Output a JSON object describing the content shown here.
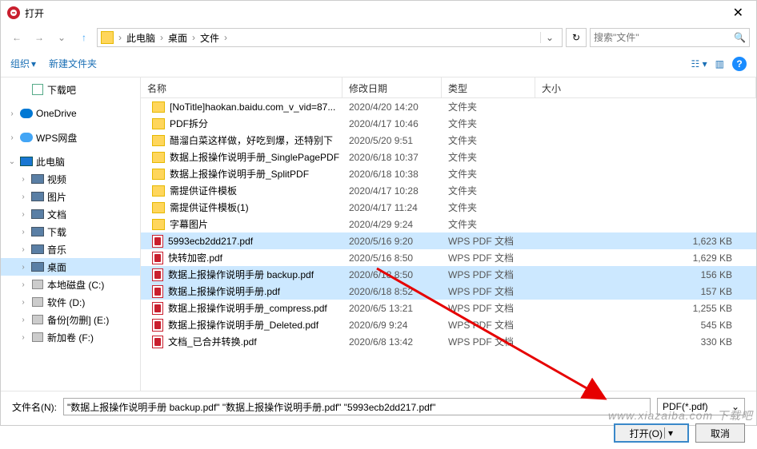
{
  "window": {
    "title": "打开"
  },
  "breadcrumb": {
    "segments": [
      "此电脑",
      "桌面",
      "文件"
    ]
  },
  "search": {
    "placeholder": "搜索\"文件\""
  },
  "toolbar": {
    "organize": "组织",
    "new_folder": "新建文件夹"
  },
  "sidebar": {
    "items": [
      {
        "label": "下载吧",
        "indent": 22,
        "exp": "",
        "icon": "download"
      },
      {
        "label": "OneDrive",
        "indent": 8,
        "exp": "›",
        "icon": "onedrive",
        "spacer_before": 8
      },
      {
        "label": "WPS网盘",
        "indent": 8,
        "exp": "›",
        "icon": "wps",
        "spacer_before": 8
      },
      {
        "label": "此电脑",
        "indent": 8,
        "exp": "⌄",
        "icon": "thispc",
        "spacer_before": 8
      },
      {
        "label": "视频",
        "indent": 22,
        "exp": "›",
        "icon": "gen"
      },
      {
        "label": "图片",
        "indent": 22,
        "exp": "›",
        "icon": "gen"
      },
      {
        "label": "文档",
        "indent": 22,
        "exp": "›",
        "icon": "gen"
      },
      {
        "label": "下载",
        "indent": 22,
        "exp": "›",
        "icon": "gen"
      },
      {
        "label": "音乐",
        "indent": 22,
        "exp": "›",
        "icon": "gen"
      },
      {
        "label": "桌面",
        "indent": 22,
        "exp": "›",
        "icon": "gen",
        "selected": true
      },
      {
        "label": "本地磁盘 (C:)",
        "indent": 22,
        "exp": "›",
        "icon": "disk"
      },
      {
        "label": "软件 (D:)",
        "indent": 22,
        "exp": "›",
        "icon": "disk"
      },
      {
        "label": "备份[勿删] (E:)",
        "indent": 22,
        "exp": "›",
        "icon": "disk"
      },
      {
        "label": "新加卷 (F:)",
        "indent": 22,
        "exp": "›",
        "icon": "disk"
      }
    ]
  },
  "columns": {
    "name": "名称",
    "date": "修改日期",
    "type": "类型",
    "size": "大小"
  },
  "files": [
    {
      "name": "[NoTitle]haokan.baidu.com_v_vid=87...",
      "date": "2020/4/20 14:20",
      "type": "文件夹",
      "size": "",
      "icon": "folder"
    },
    {
      "name": "PDF拆分",
      "date": "2020/4/17 10:46",
      "type": "文件夹",
      "size": "",
      "icon": "folder"
    },
    {
      "name": "醋溜白菜这样做，好吃到爆，还特别下",
      "date": "2020/5/20 9:51",
      "type": "文件夹",
      "size": "",
      "icon": "folder"
    },
    {
      "name": "数据上报操作说明手册_SinglePagePDF",
      "date": "2020/6/18 10:37",
      "type": "文件夹",
      "size": "",
      "icon": "folder"
    },
    {
      "name": "数据上报操作说明手册_SplitPDF",
      "date": "2020/6/18 10:38",
      "type": "文件夹",
      "size": "",
      "icon": "folder"
    },
    {
      "name": "需提供证件模板",
      "date": "2020/4/17 10:28",
      "type": "文件夹",
      "size": "",
      "icon": "folder"
    },
    {
      "name": "需提供证件模板(1)",
      "date": "2020/4/17 11:24",
      "type": "文件夹",
      "size": "",
      "icon": "folder"
    },
    {
      "name": "字幕图片",
      "date": "2020/4/29 9:24",
      "type": "文件夹",
      "size": "",
      "icon": "folder"
    },
    {
      "name": "5993ecb2dd217.pdf",
      "date": "2020/5/16 9:20",
      "type": "WPS PDF 文档",
      "size": "1,623 KB",
      "icon": "pdf",
      "selected": true
    },
    {
      "name": "快转加密.pdf",
      "date": "2020/5/16 8:50",
      "type": "WPS PDF 文档",
      "size": "1,629 KB",
      "icon": "pdf"
    },
    {
      "name": "数据上报操作说明手册 backup.pdf",
      "date": "2020/6/18 8:50",
      "type": "WPS PDF 文档",
      "size": "156 KB",
      "icon": "pdf",
      "selected": true
    },
    {
      "name": "数据上报操作说明手册.pdf",
      "date": "2020/6/18 8:52",
      "type": "WPS PDF 文档",
      "size": "157 KB",
      "icon": "pdf",
      "selected": true
    },
    {
      "name": "数据上报操作说明手册_compress.pdf",
      "date": "2020/6/5 13:21",
      "type": "WPS PDF 文档",
      "size": "1,255 KB",
      "icon": "pdf"
    },
    {
      "name": "数据上报操作说明手册_Deleted.pdf",
      "date": "2020/6/9 9:24",
      "type": "WPS PDF 文档",
      "size": "545 KB",
      "icon": "pdf"
    },
    {
      "name": "文档_已合并转换.pdf",
      "date": "2020/6/8 13:42",
      "type": "WPS PDF 文档",
      "size": "330 KB",
      "icon": "pdf"
    }
  ],
  "bottom": {
    "filename_label": "文件名(N):",
    "filename_value": "\"数据上报操作说明手册 backup.pdf\" \"数据上报操作说明手册.pdf\" \"5993ecb2dd217.pdf\"",
    "filter": "PDF(*.pdf)",
    "open": "打开(O)",
    "cancel": "取消"
  },
  "watermark": "www.xiazaiba.com 下载吧"
}
